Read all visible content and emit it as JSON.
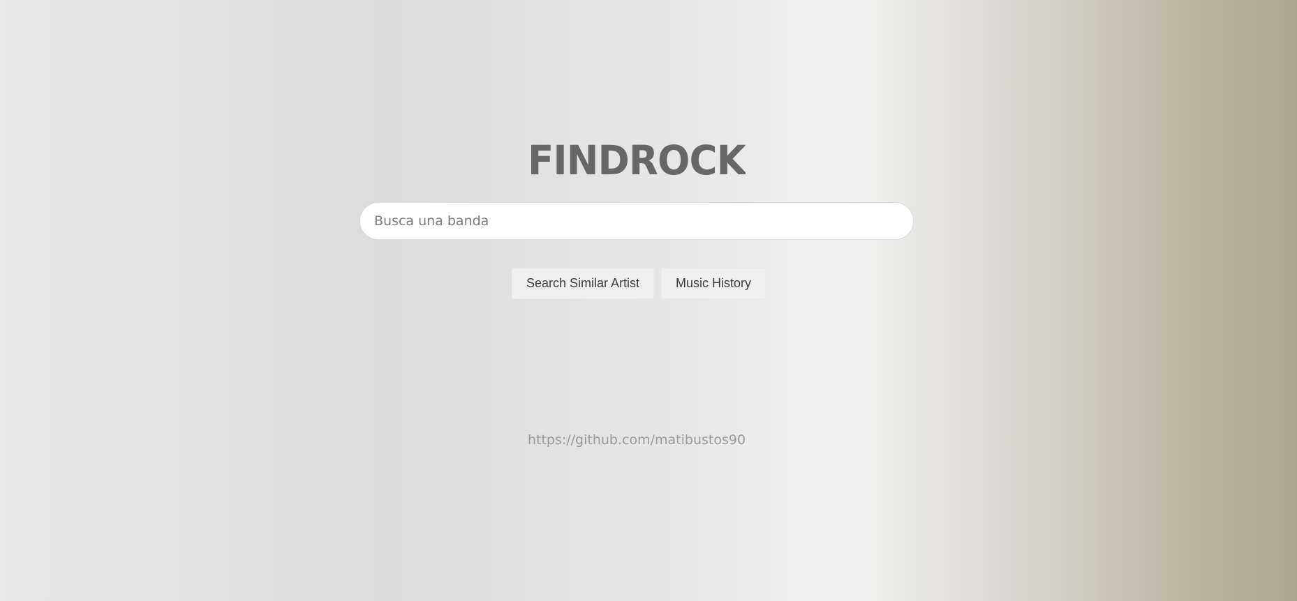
{
  "logo": {
    "text": "FINDROCK",
    "color": "#676767"
  },
  "search": {
    "placeholder": "Busca una banda",
    "value": ""
  },
  "buttons": {
    "similar_artist_label": "Search Similar Artist",
    "music_history_label": "Music History"
  },
  "footer": {
    "link_text": "https://github.com/matibustos90"
  },
  "colors": {
    "background_left": "#e9e9e9",
    "background_right": "#a9a690",
    "button_bg": "#f0f0f0",
    "footer_text": "#9a9a9a"
  }
}
